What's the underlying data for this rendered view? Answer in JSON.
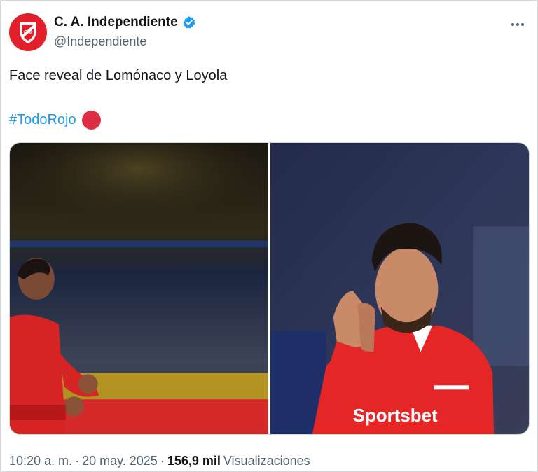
{
  "account": {
    "display_name": "C. A. Independiente",
    "handle": "@Independiente",
    "verified": true,
    "avatar_color": "#e2202c"
  },
  "tweet": {
    "text": "Face reveal de Lomónaco y Loyola",
    "hashtag": "#TodoRojo",
    "emoji": "red-circle"
  },
  "media": {
    "photos": [
      {
        "alt": "player-celebrating-left"
      },
      {
        "alt": "player-clapping-right"
      }
    ],
    "shirt_sponsor_text": "Sportsbet"
  },
  "footer": {
    "time": "10:20 a. m.",
    "separator": "·",
    "date": "20 may. 2025",
    "views_count": "156,9 mil",
    "views_label": "Visualizaciones"
  },
  "colors": {
    "link": "#1d9bf0",
    "verified_badge": "#1d9bf0",
    "secondary_text": "#536471",
    "club_red": "#e2202c"
  }
}
